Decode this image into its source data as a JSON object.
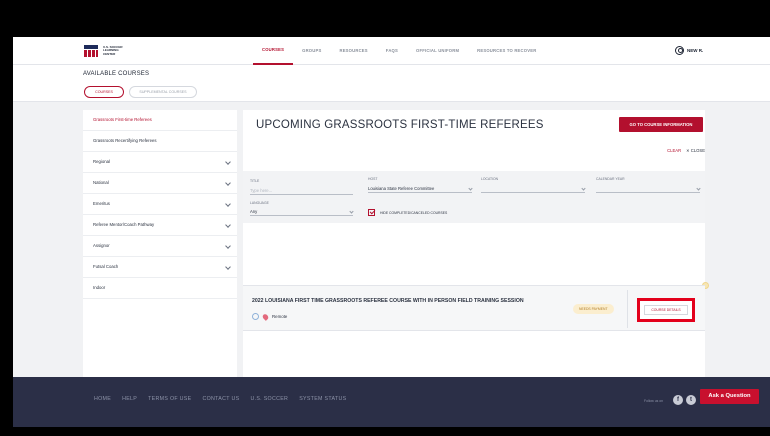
{
  "header": {
    "logo_text": "U.S. SOCCER LEARNING CENTER",
    "nav": [
      "COURSES",
      "GROUPS",
      "RESOURCES",
      "FAQS",
      "OFFICIAL UNIFORM",
      "RESOURCES TO RECOVER"
    ],
    "user_name": "NEW R."
  },
  "courses_bar": {
    "title": "AVAILABLE COURSES",
    "tabs": [
      "COURSES",
      "SUPPLEMENTAL COURSES"
    ]
  },
  "sidebar": {
    "items": [
      {
        "label": "Grassroots First-time Referees",
        "active": true,
        "expandable": false
      },
      {
        "label": "Grassroots Recertifying Referees",
        "active": false,
        "expandable": false
      },
      {
        "label": "Regional",
        "active": false,
        "expandable": true
      },
      {
        "label": "National",
        "active": false,
        "expandable": true
      },
      {
        "label": "Emeritus",
        "active": false,
        "expandable": true
      },
      {
        "label": "Referee Mentor/Coach Pathway",
        "active": false,
        "expandable": true
      },
      {
        "label": "Assignor",
        "active": false,
        "expandable": true
      },
      {
        "label": "Futsal Coach",
        "active": false,
        "expandable": true
      },
      {
        "label": "Indoor",
        "active": false,
        "expandable": false
      }
    ]
  },
  "main": {
    "title": "UPCOMING GRASSROOTS FIRST-TIME REFEREES",
    "goto_label": "GO TO COURSE INFORMATION",
    "clear_label": "CLEAR",
    "close_label": "CLOSE",
    "filters": {
      "title_label": "TITLE",
      "title_placeholder": "Type here...",
      "host_label": "HOST",
      "host_value": "Louisiana State Referee Committee",
      "location_label": "LOCATION",
      "calendar_label": "CALENDAR YEAR",
      "language_label": "LANGUAGE",
      "language_value": "Any",
      "hide_completed_label": "HIDE COMPLETED/CANCELED COURSES"
    },
    "course": {
      "title": "2022 LOUISIANA FIRST TIME GRASSROOTS REFEREE COURSE WITH IN PERSON FIELD TRAINING SESSION",
      "location": "Remote",
      "status": "NEEDS PAYMENT",
      "details_label": "COURSE DETAILS"
    }
  },
  "footer": {
    "links": [
      "HOME",
      "HELP",
      "TERMS OF USE",
      "CONTACT US",
      "U.S. SOCCER",
      "SYSTEM STATUS"
    ],
    "follow_label": "Follow us on",
    "ask_label": "Ask a Question"
  },
  "colors": {
    "accent": "#b3102e",
    "footer_bg": "#2b2f47",
    "highlight": "#e3001b"
  }
}
